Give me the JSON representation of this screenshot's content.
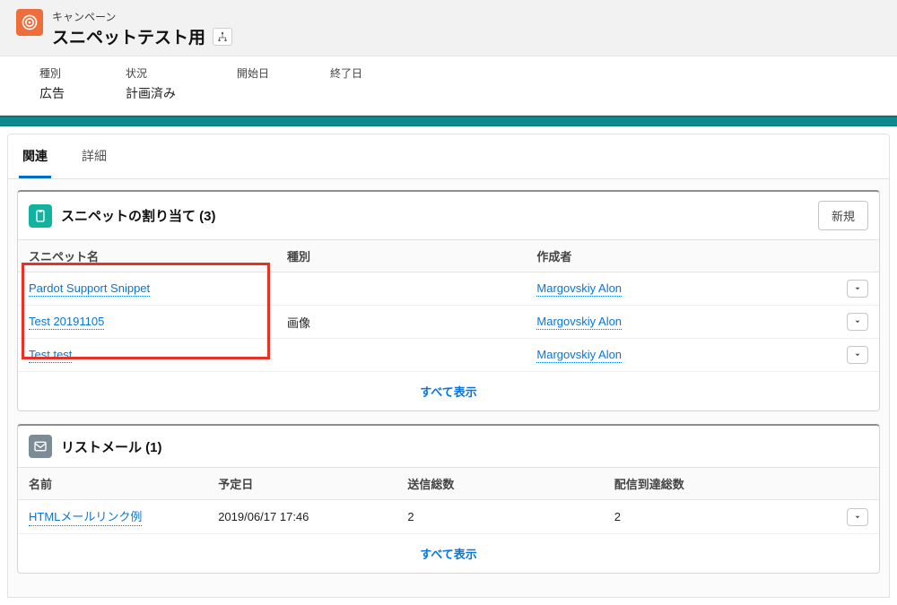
{
  "header": {
    "entity_type": "キャンペーン",
    "title": "スニペットテスト用"
  },
  "highlights": {
    "type_label": "種別",
    "type_value": "広告",
    "status_label": "状況",
    "status_value": "計画済み",
    "start_label": "開始日",
    "start_value": "",
    "end_label": "終了日",
    "end_value": ""
  },
  "tabs": {
    "related": "関連",
    "detail": "詳細"
  },
  "snippet_card": {
    "title": "スニペットの割り当て (3)",
    "new_btn": "新規",
    "columns": {
      "name": "スニペット名",
      "type": "種別",
      "created_by": "作成者"
    },
    "rows": [
      {
        "name": "Pardot Support Snippet",
        "type": "",
        "created_by": "Margovskiy Alon"
      },
      {
        "name": "Test 20191105",
        "type": "画像",
        "created_by": "Margovskiy Alon"
      },
      {
        "name": "Test test",
        "type": "",
        "created_by": "Margovskiy Alon"
      }
    ],
    "footer": "すべて表示"
  },
  "listmail_card": {
    "title": "リストメール (1)",
    "columns": {
      "name": "名前",
      "scheduled": "予定日",
      "sent": "送信総数",
      "delivered": "配信到達総数"
    },
    "rows": [
      {
        "name": "HTMLメールリンク例",
        "scheduled": "2019/06/17 17:46",
        "sent": "2",
        "delivered": "2"
      }
    ],
    "footer": "すべて表示"
  }
}
